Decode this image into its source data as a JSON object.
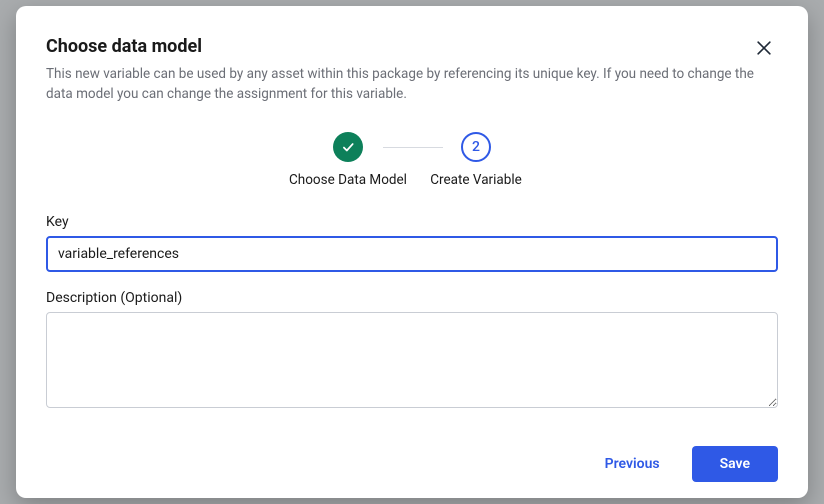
{
  "modal": {
    "title": "Choose data model",
    "subtitle": "This new variable can be used by any asset within this package by referencing its unique key. If you need to change the data model you can change the assignment for this variable."
  },
  "stepper": {
    "step1": {
      "label": "Choose Data Model"
    },
    "step2": {
      "label": "Create Variable",
      "number": "2"
    }
  },
  "form": {
    "key_label": "Key",
    "key_value": "variable_references",
    "desc_label": "Description (Optional)",
    "desc_value": ""
  },
  "footer": {
    "previous": "Previous",
    "save": "Save"
  }
}
